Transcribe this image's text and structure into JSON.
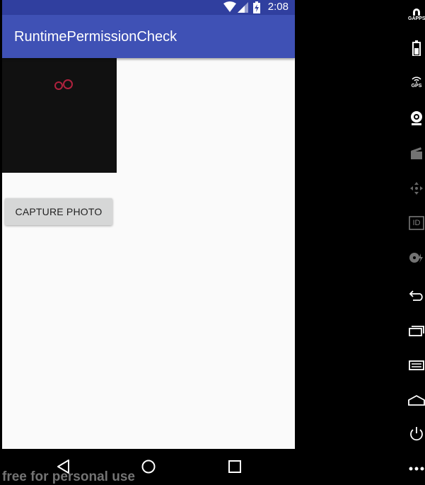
{
  "status_bar": {
    "time": "2:08",
    "icons": [
      "wifi-icon",
      "signal-icon",
      "battery-charging-icon"
    ]
  },
  "app_bar": {
    "title": "RuntimePermissionCheck"
  },
  "content": {
    "image_preview": {
      "icon": "placeholder-image-icon"
    },
    "capture_button_label": "CAPTURE PHOTO"
  },
  "nav_bar": {
    "icons": [
      "back-icon",
      "home-icon",
      "recents-icon"
    ]
  },
  "watermark": "free for personal use",
  "side_toolbar": {
    "gapps_label": "GAPPS",
    "gps_label": "GPS",
    "id_label": "ID"
  },
  "colors": {
    "primary": "#3F51B5",
    "primary_dark": "#303F9F",
    "background": "#FAFAFA",
    "button": "#D6D7D7"
  }
}
